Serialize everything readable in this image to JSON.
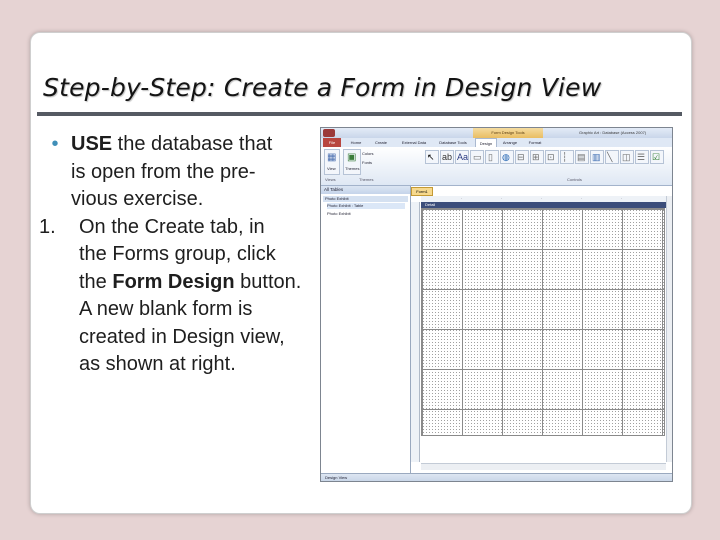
{
  "slide": {
    "title": "Step-by-Step: Create a Form in Design View",
    "bullets": [
      {
        "marker": "•",
        "lines": [
          {
            "bold": "USE",
            "text": " the database that"
          },
          {
            "text": "is open from the pre-"
          },
          {
            "text": "vious exercise."
          }
        ]
      },
      {
        "marker": "1.",
        "lines": [
          {
            "text": "On the Create tab, in"
          },
          {
            "text": "the Forms group, click"
          },
          {
            "pre": "the ",
            "bold": "Form Design",
            "post": " button."
          },
          {
            "text": "A new blank form is"
          },
          {
            "text": "created in Design view,"
          },
          {
            "text": "as shown at right."
          }
        ]
      }
    ]
  },
  "screenshot": {
    "app_title": "Graphic Art : Database (Access 2007)",
    "context_tab": "Form Design Tools",
    "tabs": [
      "File",
      "Home",
      "Create",
      "External Data",
      "Database Tools",
      "Design",
      "Arrange",
      "Format"
    ],
    "selected_tab": "Design",
    "groups": [
      "Views",
      "Themes",
      "Controls"
    ],
    "view_label": "View",
    "themes_label": "Themes",
    "colors_label": "Colors",
    "fonts_label": "Fonts",
    "nav_header": "All Tables",
    "nav_group": "Photo Exhibit",
    "nav_items": [
      "Photo Exhibit : Table",
      "Photo Exhibit"
    ],
    "doc_tab": "Form1",
    "section": "Detail",
    "status": "Design View"
  },
  "colors": {
    "background": "#e6d3d3",
    "title_rule": "#555a63",
    "bullet_marker": "#3f8fb8",
    "file_tab": "#b8463f"
  }
}
